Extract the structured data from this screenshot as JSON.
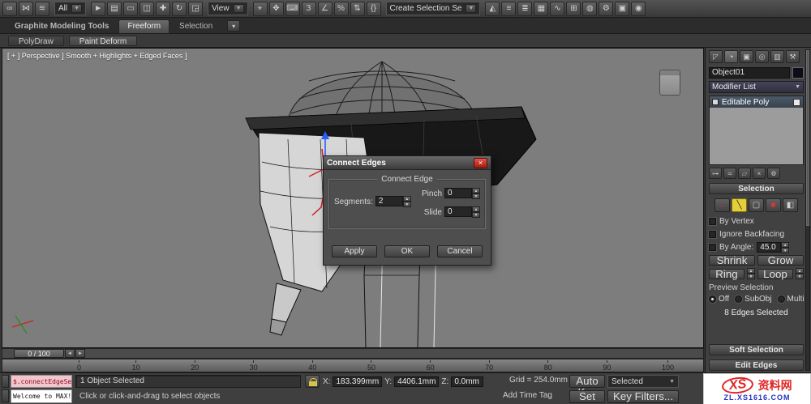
{
  "glyphs": {
    "arrow_down": "▼",
    "arrow_up": "▲",
    "close": "×",
    "step_back": "◄",
    "step_fwd": "►",
    "tab_menu": "▾"
  },
  "topbar": {
    "selection_filter": "All",
    "ref_coord": "View",
    "named_selection": "Create Selection Se",
    "icons_a": [
      {
        "name": "select-and-link-icon",
        "glyph": "∞"
      },
      {
        "name": "unlink-selection-icon",
        "glyph": "⋈"
      },
      {
        "name": "bind-to-spacewarp-icon",
        "glyph": "≋"
      }
    ],
    "icons_b": [
      {
        "name": "select-object-icon",
        "glyph": "►"
      },
      {
        "name": "select-by-name-icon",
        "glyph": "▤"
      },
      {
        "name": "rectangular-selection-icon",
        "glyph": "▭"
      },
      {
        "name": "window-crossing-icon",
        "glyph": "◫"
      },
      {
        "name": "select-and-move-icon",
        "glyph": "✚"
      },
      {
        "name": "select-and-rotate-icon",
        "glyph": "↻"
      },
      {
        "name": "select-and-scale-icon",
        "glyph": "◲"
      }
    ],
    "icons_c": [
      {
        "name": "use-pivot-center-icon",
        "glyph": "⌖"
      },
      {
        "name": "select-and-manipulate-icon",
        "glyph": "✥"
      },
      {
        "name": "keyboard-override-icon",
        "glyph": "⌨"
      },
      {
        "name": "snaps-toggle-icon",
        "glyph": "3"
      },
      {
        "name": "angle-snap-icon",
        "glyph": "∠"
      },
      {
        "name": "percent-snap-icon",
        "glyph": "%"
      },
      {
        "name": "spinner-snap-icon",
        "glyph": "⇅"
      },
      {
        "name": "edit-named-selection-sets-icon",
        "glyph": "{}"
      }
    ],
    "icons_d": [
      {
        "name": "mirror-icon",
        "glyph": "◭"
      },
      {
        "name": "align-icon",
        "glyph": "≡"
      },
      {
        "name": "layer-manager-icon",
        "glyph": "≣"
      },
      {
        "name": "ribbon-toggle-icon",
        "glyph": "▦"
      },
      {
        "name": "curve-editor-icon",
        "glyph": "∿"
      },
      {
        "name": "schematic-view-icon",
        "glyph": "⊞"
      },
      {
        "name": "material-editor-icon",
        "glyph": "◍"
      },
      {
        "name": "render-setup-icon",
        "glyph": "⚙"
      },
      {
        "name": "rendered-frame-icon",
        "glyph": "▣"
      },
      {
        "name": "render-production-icon",
        "glyph": "◉"
      }
    ]
  },
  "ribbon": {
    "tabs": [
      "Graphite Modeling Tools",
      "Freeform",
      "Selection"
    ],
    "subtabs": [
      "PolyDraw",
      "Paint Deform"
    ]
  },
  "viewport": {
    "label": "[ + ] Perspective ] Smooth + Highlights + Edged Faces ]"
  },
  "dialog": {
    "title": "Connect Edges",
    "group": "Connect Edge",
    "segments_label": "Segments:",
    "segments_value": "2",
    "pinch_label": "Pinch",
    "pinch_value": "0",
    "slide_label": "Slide",
    "slide_value": "0",
    "apply": "Apply",
    "ok": "OK",
    "cancel": "Cancel"
  },
  "panel": {
    "tabs": [
      {
        "name": "create-tab-icon",
        "glyph": "◸"
      },
      {
        "name": "modify-tab-icon",
        "glyph": "◔"
      },
      {
        "name": "hierarchy-tab-icon",
        "glyph": "▣"
      },
      {
        "name": "motion-tab-icon",
        "glyph": "◎"
      },
      {
        "name": "display-tab-icon",
        "glyph": "▥"
      },
      {
        "name": "utilities-tab-icon",
        "glyph": "⚒"
      }
    ],
    "object_name": "Object01",
    "modifier_list": "Modifier List",
    "stack_item": "Editable Poly",
    "stack_tools": [
      {
        "name": "pin-stack-icon",
        "glyph": "⊶"
      },
      {
        "name": "show-end-result-icon",
        "glyph": "≍"
      },
      {
        "name": "make-unique-icon",
        "glyph": "▱"
      },
      {
        "name": "remove-modifier-icon",
        "glyph": "×"
      },
      {
        "name": "configure-modifier-sets-icon",
        "glyph": "⚙"
      }
    ],
    "selection": {
      "title": "Selection",
      "vertex_glyph": "∴",
      "edge_glyph": "╲",
      "border_glyph": "▢",
      "polygon_glyph": "■",
      "element_glyph": "◧",
      "by_vertex": "By Vertex",
      "ignore_backfacing": "Ignore Backfacing",
      "by_angle": "By Angle:",
      "by_angle_value": "45.0",
      "shrink": "Shrink",
      "grow": "Grow",
      "ring": "Ring",
      "loop": "Loop",
      "preview": "Preview Selection",
      "off": "Off",
      "subobj": "SubObj",
      "multi": "Multi",
      "status": "8 Edges Selected"
    },
    "soft_selection": "Soft Selection",
    "edit_edges": "Edit Edges"
  },
  "timeline": {
    "slider": "0 / 100",
    "ticks": [
      "0",
      "10",
      "20",
      "30",
      "40",
      "50",
      "60",
      "70",
      "80",
      "90",
      "100"
    ]
  },
  "statusbar": {
    "macro_line": "$.connectEdgeSe",
    "listener_line": "Welcome to MAX!",
    "selected_status": "1 Object Selected",
    "prompt": "Click or click-and-drag to select objects",
    "x_label": "X:",
    "x_value": "183.399mm",
    "y_label": "Y:",
    "y_value": "4406.1mm",
    "z_label": "Z:",
    "z_value": "0.0mm",
    "grid": "Grid = 254.0mm",
    "add_time_tag": "Add Time Tag",
    "auto_key": "Auto Key",
    "selected_mode": "Selected",
    "set_key": "Set Key",
    "key_filters": "Key Filters..."
  },
  "watermark": {
    "logo": "XS",
    "site": "资料网",
    "url": "ZL.XS1616.COM"
  }
}
